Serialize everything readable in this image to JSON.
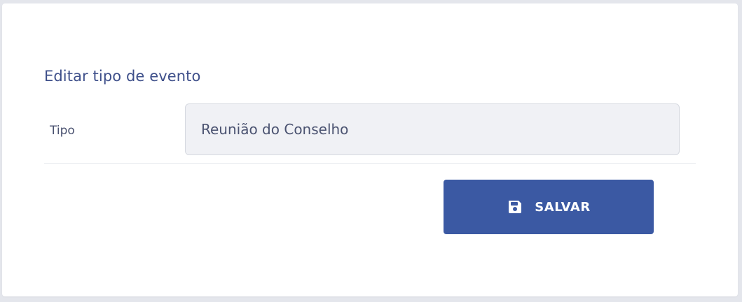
{
  "form": {
    "title": "Editar tipo de evento",
    "field_label": "Tipo",
    "field_value": "Reunião do Conselho"
  },
  "actions": {
    "save_label": "SALVAR",
    "save_icon": "floppy-disk-icon"
  },
  "colors": {
    "accent": "#3b59a3",
    "title": "#3e4f8a",
    "field_bg": "#f0f1f5"
  }
}
